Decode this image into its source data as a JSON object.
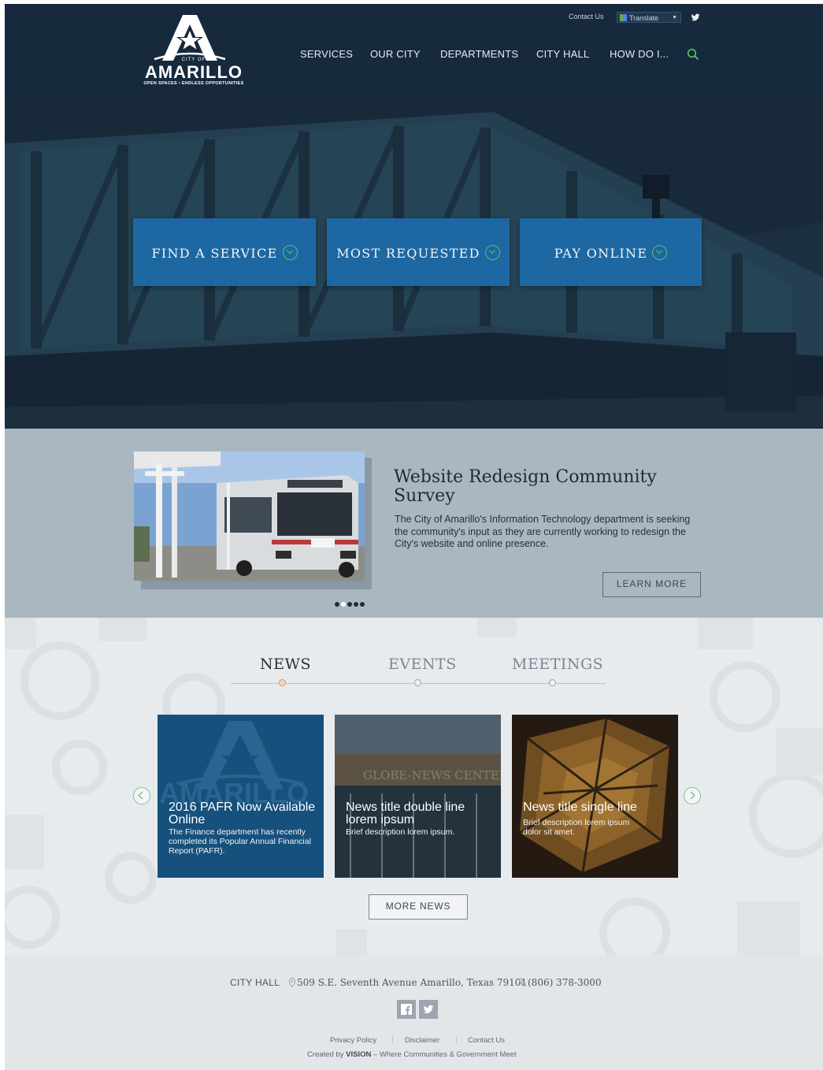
{
  "header": {
    "logo": {
      "city_of": "CITY OF",
      "name": "AMARILLO",
      "tagline": "OPEN SPACES • ENDLESS OPPORTUNITIES"
    },
    "utility": {
      "contact": "Contact Us",
      "translate": "Translate"
    },
    "nav": [
      "SERVICES",
      "OUR CITY",
      "DEPARTMENTS",
      "CITY HALL",
      "HOW DO I..."
    ]
  },
  "hero": {
    "buttons": [
      "FIND A SERVICE",
      "MOST REQUESTED",
      "PAY ONLINE"
    ]
  },
  "feature": {
    "title": "Website Redesign Community Survey",
    "description": "The City of Amarillo's Information Technology department is seeking the community's input as they are currently working to redesign the City's website and online presence.",
    "cta": "LEARN MORE",
    "slides": 5,
    "active_slide": 2
  },
  "news": {
    "tabs": [
      "NEWS",
      "EVENTS",
      "MEETINGS"
    ],
    "active_tab": "NEWS",
    "cards": [
      {
        "title": "2016 PAFR Now Available Online",
        "description": "The Finance department has recently completed its Popular Annual Financial Report (PAFR)."
      },
      {
        "title": "News title double line lorem ipsum",
        "description": "Brief description lorem ipsum."
      },
      {
        "title": "News title single line",
        "description": "Brief description lorem ipsum dolor sit amet."
      }
    ],
    "card2_sign": "GLOBE-NEWS CENTER",
    "more": "MORE NEWS"
  },
  "footer": {
    "label": "CITY HALL",
    "address": "509 S.E. Seventh Avenue Amarillo, Texas 79101",
    "phone": "(806) 378-3000",
    "links": [
      "Privacy Policy",
      "Disclaimer",
      "Contact Us"
    ],
    "credit_prefix": "Created by",
    "credit_brand": "VISION",
    "credit_suffix": "– Where Communities & Government Meet"
  },
  "colors": {
    "header": "#16293d",
    "button": "#1d6aa8",
    "accent_green": "#5fc46a",
    "feature_bg": "#a9b7c1",
    "card_blue": "#16507c"
  }
}
